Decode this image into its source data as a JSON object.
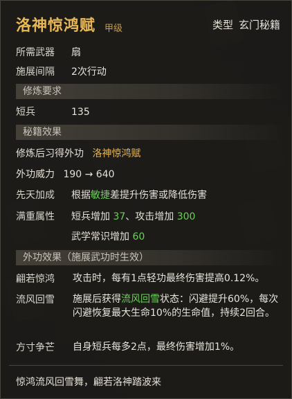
{
  "header": {
    "title": "洛神惊鸿赋",
    "grade": "甲级",
    "type_key": "类型",
    "type_value": "玄门秘籍"
  },
  "basic": {
    "weapon_key": "所需武器",
    "weapon_value": "扇",
    "interval_key": "施展间隔",
    "interval_value": "2次行动"
  },
  "requirements": {
    "title": "修炼要求",
    "short_weapon_key": "短兵",
    "short_weapon_value": "135"
  },
  "effects": {
    "title": "秘籍效果",
    "learn_key": "修炼后习得外功",
    "learn_value": "洛神惊鸿赋",
    "power_key": "外功威力",
    "power_value": "190 → 640",
    "innate_key": "先天加成",
    "innate_pre": "根据",
    "innate_attr": "敏捷",
    "innate_post": "差提升伤害或降低伤害",
    "full_key": "满重属性",
    "full_line1_a": "短兵增加 ",
    "full_line1_a_val": "37",
    "full_line1_b": "、攻击增加 ",
    "full_line1_b_val": "300",
    "full_line2": "武学常识增加 ",
    "full_line2_val": "60"
  },
  "skill_effects": {
    "title": "外功效果（施展武功时生效）",
    "item1_key": "翩若惊鸿",
    "item1_desc": "攻击时，每有1点轻功最终伤害提高0.12%。",
    "item2_key": "流风回雪",
    "item2_pre": "施展后获得",
    "item2_status": "流风回雪",
    "item2_post": "状态：闪避提升60%，每次闪避恢复最大生命10%的生命值，持续2回合。",
    "item3_key": "方寸争芒",
    "item3_desc": "自身短兵每多2点，最终伤害增加1%。"
  },
  "footer": {
    "flavor": "惊鸿流风回雪舞，翩若洛神踏波来"
  },
  "colors": {
    "title": "#e9b856",
    "green": "#6cd05a",
    "text": "#e4e0d7"
  }
}
